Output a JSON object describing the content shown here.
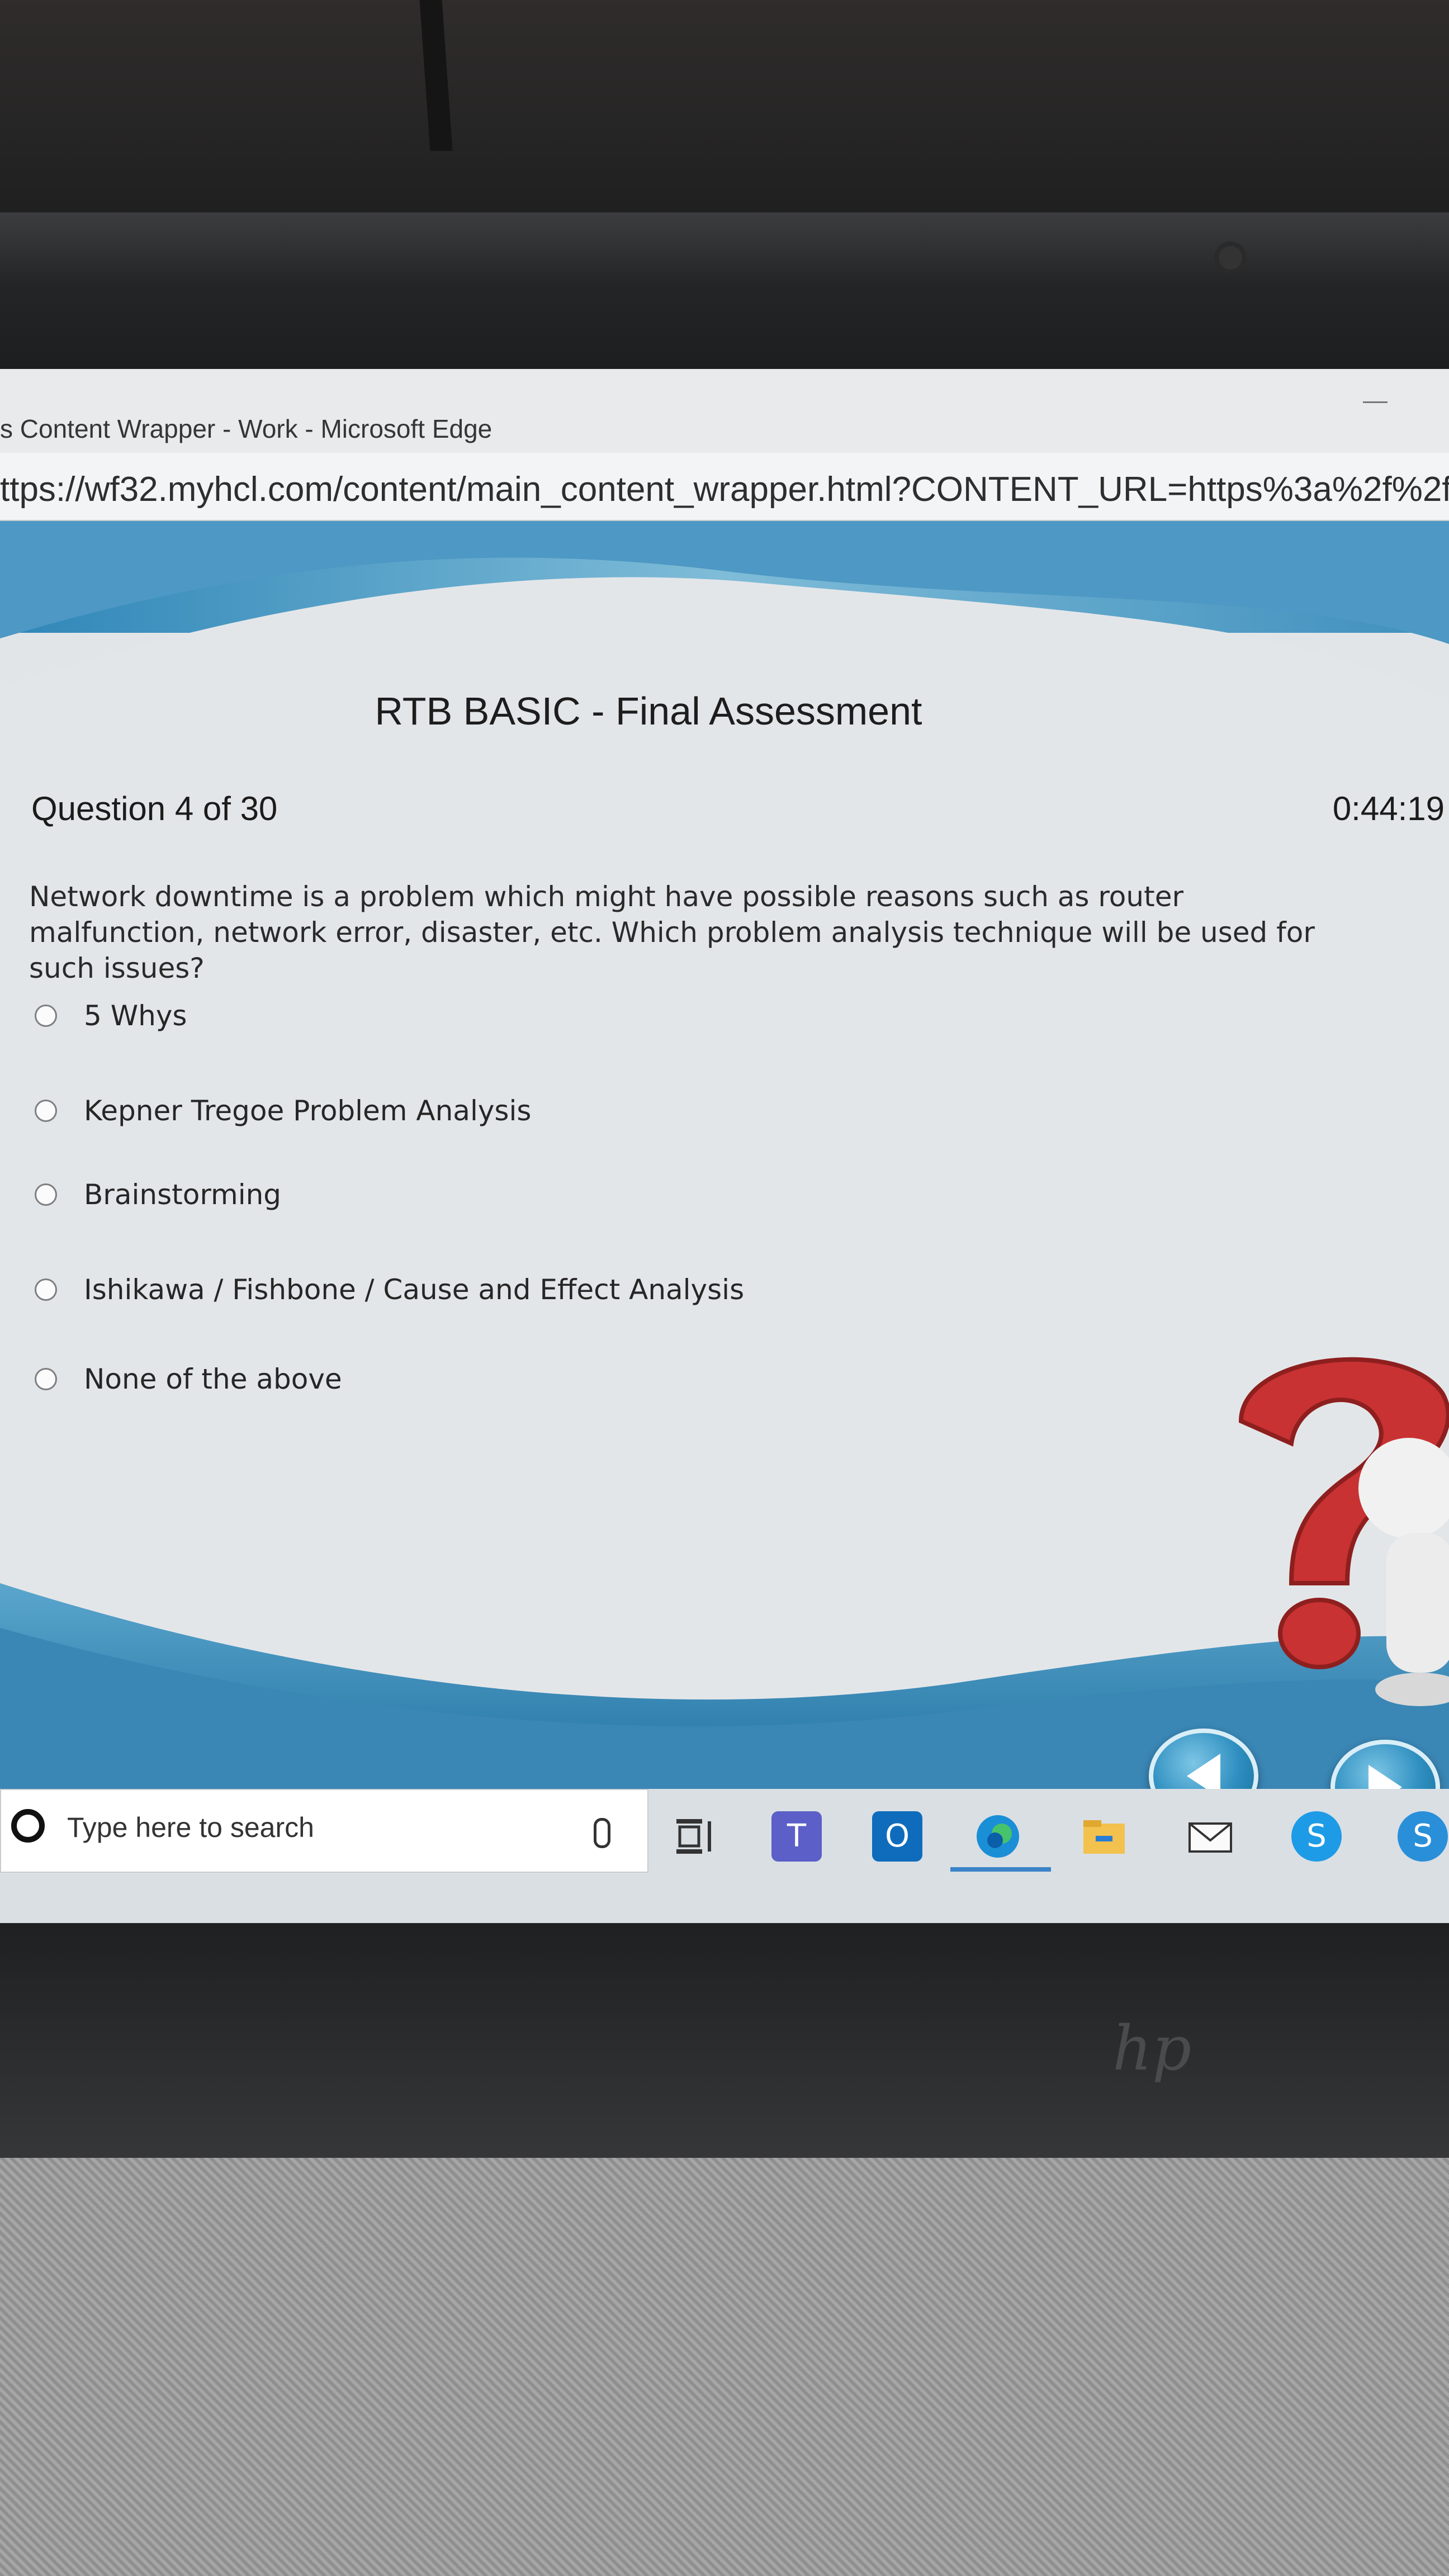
{
  "window": {
    "title": "s Content Wrapper - Work - Microsoft Edge",
    "url": "ttps://wf32.myhcl.com/content/main_content_wrapper.html?CONTENT_URL=https%3a%2f%2fwf"
  },
  "assessment": {
    "title": "RTB BASIC - Final Assessment",
    "question_number": "Question 4 of 30",
    "timer": "0:44:19",
    "question_lines": [
      "Network downtime is a problem which might have possible reasons such as router",
      "malfunction, network error, disaster, etc. Which problem analysis technique will be used for",
      "such issues?"
    ],
    "options": [
      {
        "label": "5 Whys"
      },
      {
        "label": "Kepner Tregoe Problem Analysis"
      },
      {
        "label": "Brainstorming"
      },
      {
        "label": "Ishikawa / Fishbone / Cause and Effect Analysis"
      },
      {
        "label": "None of the above"
      }
    ],
    "nav": {
      "prev_icon": "previous-arrow-icon",
      "next_icon": "next-arrow-icon"
    }
  },
  "taskbar": {
    "search_placeholder": "Type here to search",
    "apps": [
      {
        "icon": "task-view-icon"
      },
      {
        "icon": "teams-icon",
        "letter": "T"
      },
      {
        "icon": "outlook-icon",
        "letter": "O"
      },
      {
        "icon": "edge-icon"
      },
      {
        "icon": "file-explorer-icon"
      },
      {
        "icon": "mail-icon"
      },
      {
        "icon": "skype-icon",
        "letter": "S"
      },
      {
        "icon": "skype-business-icon",
        "letter": "S"
      }
    ]
  }
}
